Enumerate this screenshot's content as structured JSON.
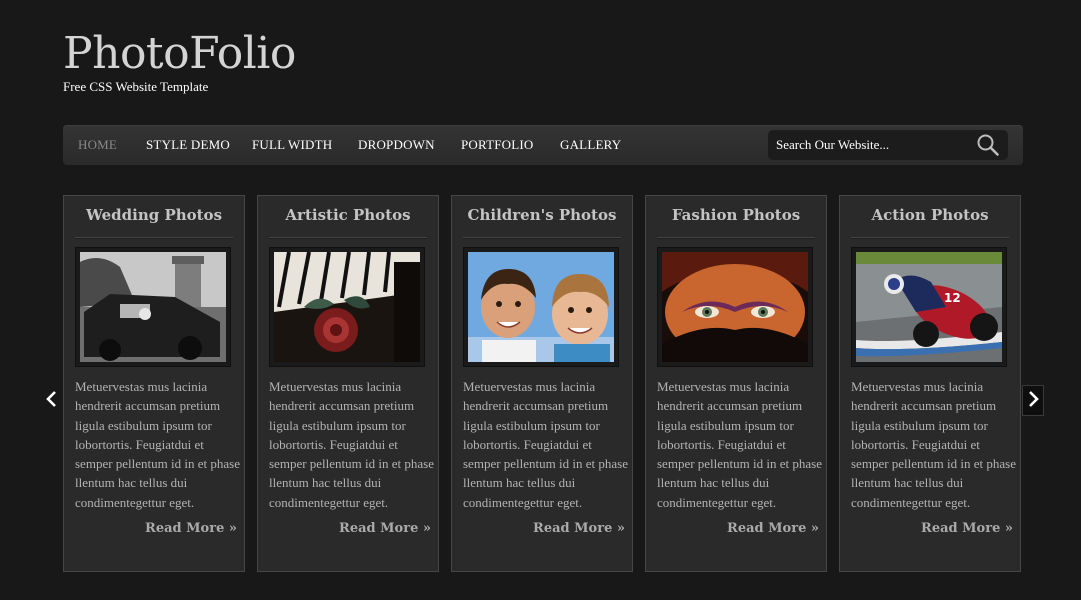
{
  "site": {
    "logo": "PhotoFolio",
    "tagline": "Free CSS Website Template"
  },
  "nav": {
    "items": [
      {
        "label": "HOME",
        "active": true
      },
      {
        "label": "STYLE DEMO",
        "active": false
      },
      {
        "label": "FULL WIDTH",
        "active": false
      },
      {
        "label": "DROPDOWN",
        "active": false
      },
      {
        "label": "PORTFOLIO",
        "active": false
      },
      {
        "label": "GALLERY",
        "active": false
      }
    ]
  },
  "search": {
    "placeholder": "Search Our Website...",
    "icon": "magnifier-icon"
  },
  "cards": [
    {
      "title": "Wedding Photos",
      "text": "Metuervestas mus lacinia hendrerit accumsan pretium ligula estibulum ipsum tor lobortortis. Feugiatdui et semper pellentum id in et phase llentum hac tellus dui condimentegettur eget.",
      "read_more": "Read More »",
      "image": "vintage car at wedding in front of tower (black and white)"
    },
    {
      "title": "Artistic Photos",
      "text": "Metuervestas mus lacinia hendrerit accumsan pretium ligula estibulum ipsum tor lobortortis. Feugiatdui et semper pellentum id in et phase llentum hac tellus dui condimentegettur eget.",
      "read_more": "Read More »",
      "image": "red rose on piano keys"
    },
    {
      "title": "Children's Photos",
      "text": "Metuervestas mus lacinia hendrerit accumsan pretium ligula estibulum ipsum tor lobortortis. Feugiatdui et semper pellentum id in et phase llentum hac tellus dui condimentegettur eget.",
      "read_more": "Read More »",
      "image": "two smiling boys against blue sky"
    },
    {
      "title": "Fashion Photos",
      "text": "Metuervestas mus lacinia hendrerit accumsan pretium ligula estibulum ipsum tor lobortortis. Feugiatdui et semper pellentum id in et phase llentum hac tellus dui condimentegettur eget.",
      "read_more": "Read More »",
      "image": "woman with veiled face and dramatic eye makeup"
    },
    {
      "title": "Action Photos",
      "text": "Metuervestas mus lacinia hendrerit accumsan pretium ligula estibulum ipsum tor lobortortis. Feugiatdui et semper pellentum id in et phase llentum hac tellus dui condimentegettur eget.",
      "read_more": "Read More »",
      "image": "motorcycle racer leaning into a turn"
    }
  ],
  "carousel": {
    "prev_icon": "chevron-left-icon",
    "next_icon": "chevron-right-icon"
  },
  "colors": {
    "background": "#181818",
    "card": "#2a2a2a",
    "nav": "#303030",
    "active_nav": "#8a8a8a"
  }
}
